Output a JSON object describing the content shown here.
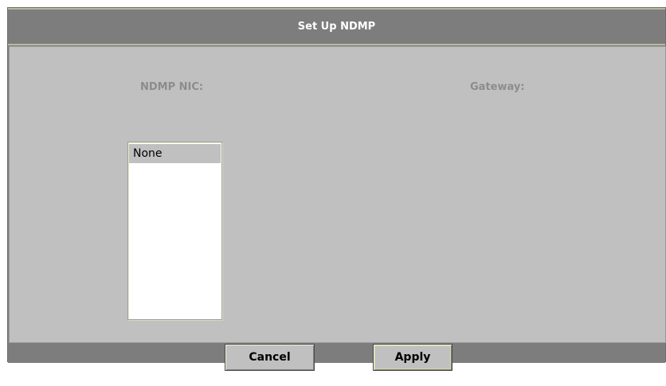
{
  "dialog": {
    "title": "Set Up NDMP",
    "nic_label": "NDMP NIC:",
    "gateway_label": "Gateway:",
    "nic_list": [
      "None"
    ],
    "selected_index": 0,
    "buttons": {
      "cancel": "Cancel",
      "apply": "Apply"
    }
  }
}
